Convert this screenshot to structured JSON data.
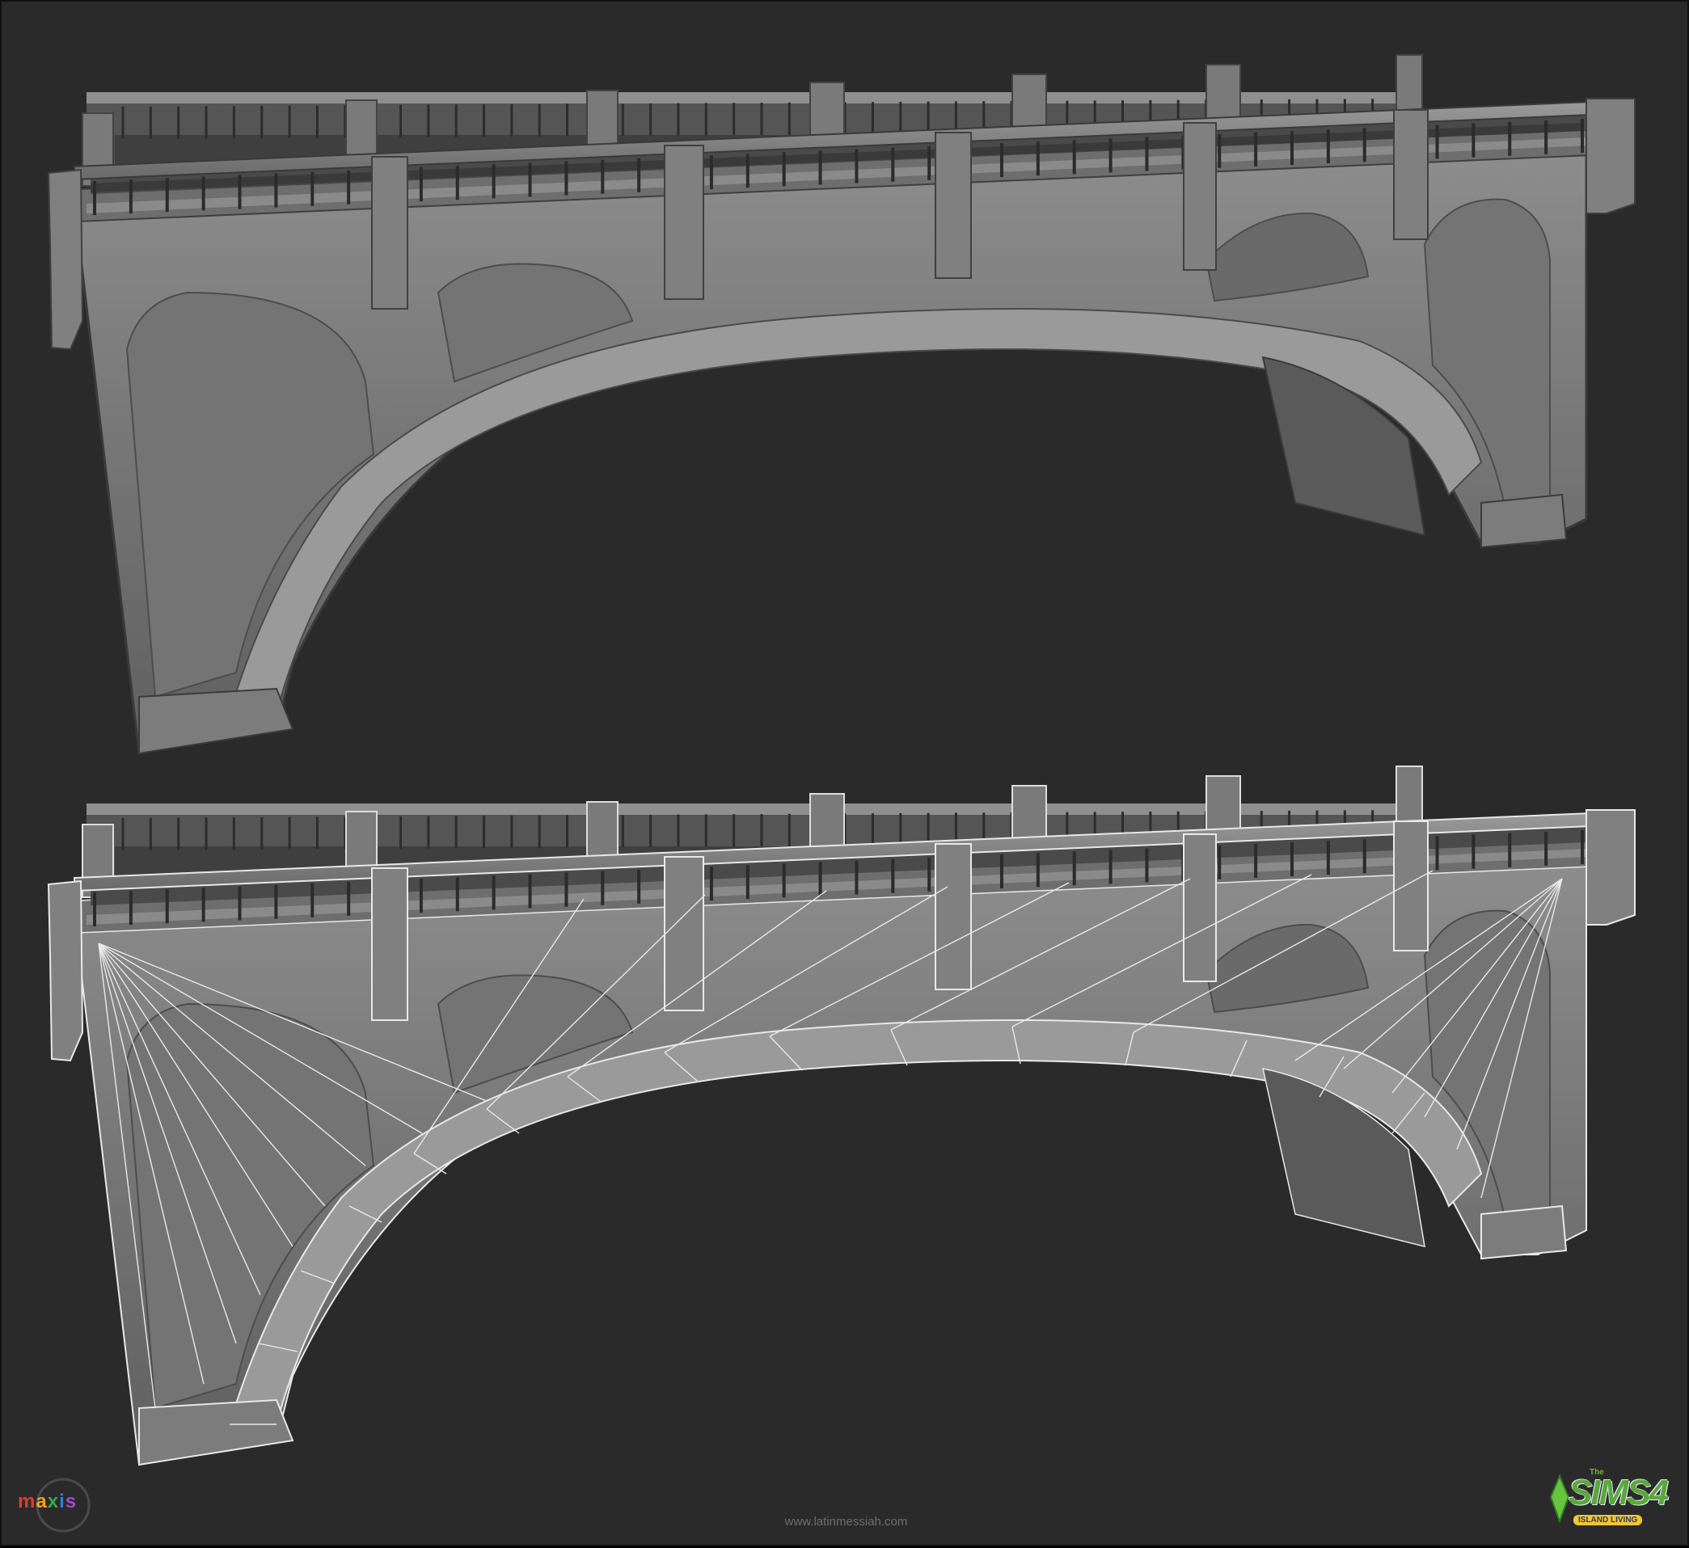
{
  "watermark": "www.latinmessiah.com",
  "logos": {
    "maxis": "maxis",
    "sims_the": "The",
    "sims_title": "SIMS4",
    "sims_subtitle": "ISLAND LIVING"
  },
  "colors": {
    "background": "#2a2a2b",
    "model_light": "#8a8a8a",
    "model_mid": "#6f6f6f",
    "model_dark": "#4d4d4d",
    "wireframe": "#e8e8e8",
    "sims_green": "#5aa83a",
    "sims_yellow": "#f3c531"
  },
  "renders": [
    {
      "name": "shaded-render",
      "wireframe": false
    },
    {
      "name": "wireframe-render",
      "wireframe": true
    }
  ]
}
